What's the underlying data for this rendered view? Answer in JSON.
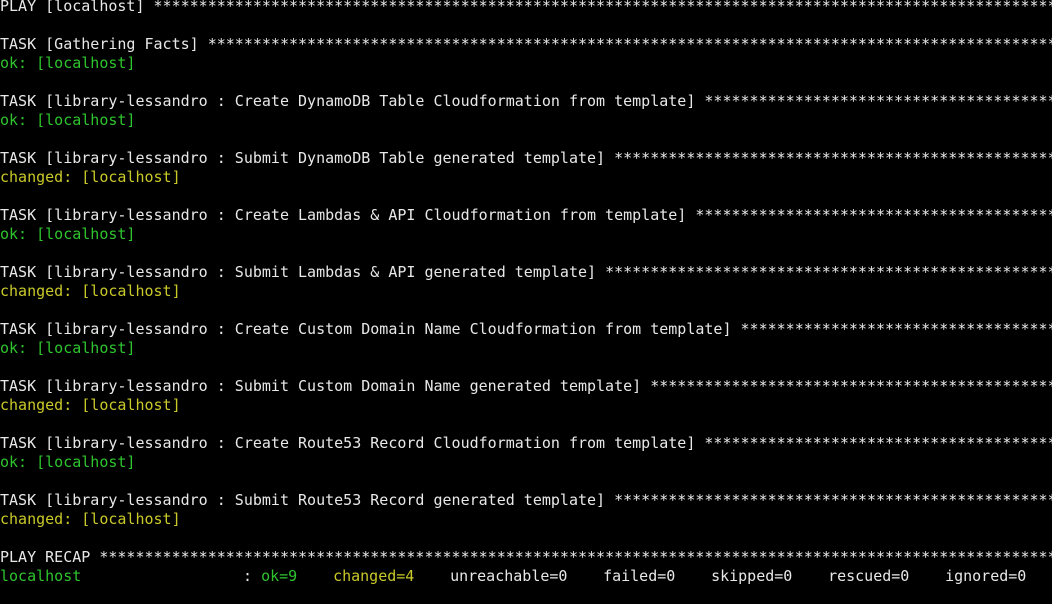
{
  "play_header": "PLAY [localhost] ",
  "tasks": [
    {
      "header": "TASK [Gathering Facts] ",
      "result": "ok: [localhost]",
      "status": "ok"
    },
    {
      "header": "TASK [library-lessandro : Create DynamoDB Table Cloudformation from template] ",
      "result": "ok: [localhost]",
      "status": "ok"
    },
    {
      "header": "TASK [library-lessandro : Submit DynamoDB Table generated template] ",
      "result": "changed: [localhost]",
      "status": "changed"
    },
    {
      "header": "TASK [library-lessandro : Create Lambdas & API Cloudformation from template] ",
      "result": "ok: [localhost]",
      "status": "ok"
    },
    {
      "header": "TASK [library-lessandro : Submit Lambdas & API generated template] ",
      "result": "changed: [localhost]",
      "status": "changed"
    },
    {
      "header": "TASK [library-lessandro : Create Custom Domain Name Cloudformation from template] ",
      "result": "ok: [localhost]",
      "status": "ok"
    },
    {
      "header": "TASK [library-lessandro : Submit Custom Domain Name generated template] ",
      "result": "changed: [localhost]",
      "status": "changed"
    },
    {
      "header": "TASK [library-lessandro : Create Route53 Record Cloudformation from template] ",
      "result": "ok: [localhost]",
      "status": "ok"
    },
    {
      "header": "TASK [library-lessandro : Submit Route53 Record generated template] ",
      "result": "changed: [localhost]",
      "status": "changed"
    }
  ],
  "recap": {
    "header": "PLAY RECAP ",
    "host": "localhost",
    "separator": ": ",
    "ok": "ok=9",
    "changed": "changed=4",
    "unreachable": "unreachable=0",
    "failed": "failed=0",
    "skipped": "skipped=0",
    "rescued": "rescued=0",
    "ignored": "ignored=0"
  },
  "colors": {
    "background": "#000000",
    "text": "#e8e8e8",
    "ok": "#2ec42e",
    "changed": "#c9c92a"
  }
}
